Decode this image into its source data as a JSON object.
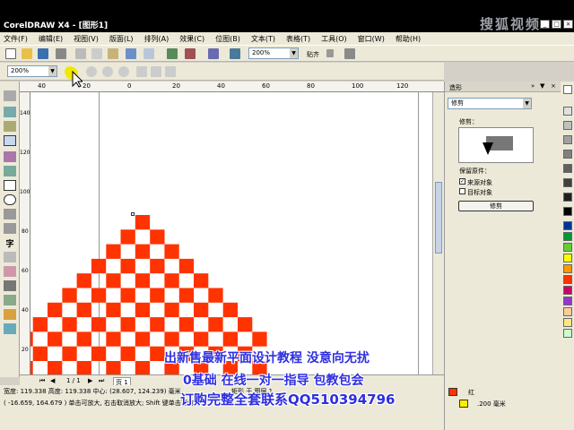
{
  "window": {
    "title": "CorelDRAW X4 - [图形1]",
    "watermark": "搜狐视频"
  },
  "menu": [
    "文件(F)",
    "编辑(E)",
    "视图(V)",
    "版面(L)",
    "排列(A)",
    "效果(C)",
    "位图(B)",
    "文本(T)",
    "表格(T)",
    "工具(O)",
    "窗口(W)",
    "帮助(H)"
  ],
  "toolbar": {
    "zoom_main": "200%",
    "snap_label": "贴齐",
    "zoom_left": "200%"
  },
  "ruler": {
    "top": [
      "40",
      "20",
      "0",
      "20",
      "40",
      "60",
      "80",
      "100",
      "120"
    ],
    "left": [
      "140",
      "120",
      "100",
      "80",
      "60",
      "40",
      "20"
    ]
  },
  "pagebar": {
    "page": "1 / 1",
    "tab": "页 1"
  },
  "status": {
    "line1": "宽度: 119.338  高度: 119.338  中心: (28.607, 124.239)  毫米",
    "line2": "( -16.659, 164.679 )   单击可放大, 右击取消放大; Shift 键单击可缩小",
    "obj": "矩形 于 图层 1",
    "fill": "红",
    "outline": ".200 毫米"
  },
  "docker": {
    "title": "造形",
    "mode": "修剪",
    "preview_label": "修剪：",
    "keep_label": "保留原件：",
    "source": "来源对象",
    "target": "目标对象",
    "apply": "修剪"
  },
  "promo": {
    "l1": "出新售最新平面设计教程 没意向无扰",
    "l2": "0基础 在线一对一指导 包教包会",
    "l3": "订购完整全套联系QQ510394796"
  },
  "colors": {
    "checker": "#ff3300",
    "promo": "#2f2fe0"
  }
}
